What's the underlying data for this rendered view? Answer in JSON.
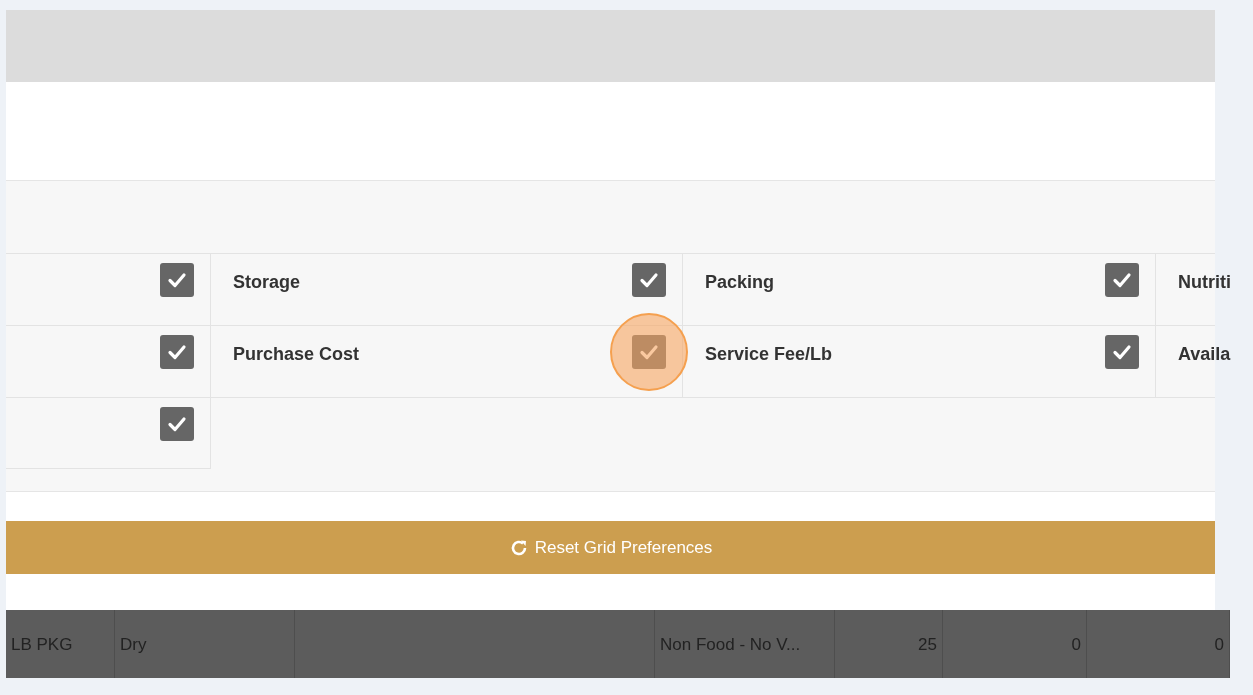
{
  "option_rows": [
    [
      {
        "checked": true,
        "highlighted": false
      },
      {
        "label": "Storage",
        "checked": true,
        "highlighted": false
      },
      {
        "label": "Packing",
        "checked": true,
        "highlighted": false
      },
      {
        "label": "Nutriti"
      }
    ],
    [
      {
        "checked": true,
        "highlighted": false
      },
      {
        "label": "Purchase Cost",
        "checked": true,
        "highlighted": true
      },
      {
        "label": "Service Fee/Lb",
        "checked": true,
        "highlighted": false
      },
      {
        "label": "Availa"
      }
    ],
    [
      {
        "checked": true,
        "highlighted": false
      }
    ]
  ],
  "reset_button": {
    "label": "Reset Grid Preferences"
  },
  "table_rows": [
    {
      "cells": [
        {
          "text": "LB PKG"
        },
        {
          "text": "Dry"
        },
        {},
        {
          "text": "Non Food - No V..."
        },
        {
          "text": "25"
        },
        {
          "text": "0"
        },
        {
          "text": "0"
        }
      ]
    }
  ]
}
